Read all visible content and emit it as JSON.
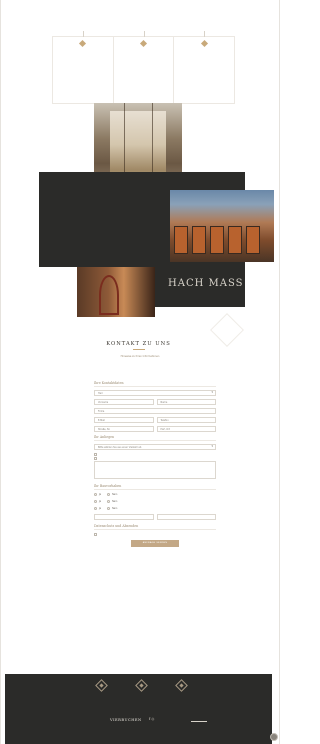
{
  "brand": {
    "wordmark": "HACH MASS"
  },
  "contact": {
    "title": "KONTAKT ZU UNS",
    "privacy_link": "Hinweise zu Ihren Informationen",
    "sections": {
      "personal": "Ihre Kontaktdaten",
      "request": "Ihr Anliegen",
      "details": "Ihr Bauvorhaben",
      "privacy": "Datenschutz und Absenden"
    },
    "fields": {
      "salutation": "Herr",
      "firstname": "Vorname",
      "lastname": "Name",
      "company": "Firma",
      "email": "E-Mail",
      "phone": "Telefon",
      "street": "Straße, Nr.",
      "zip": "PLZ, Ort",
      "topic": "Bitte wählen Sie aus einer Vielzahl ab"
    },
    "options": {
      "yes": "Ja",
      "no": "Nein"
    },
    "submit_label": "ANFRAGE SENDEN"
  },
  "footer": {
    "items": [
      {
        "icon": "diamond-icon"
      },
      {
        "icon": "diamond-icon"
      },
      {
        "icon": "diamond-icon"
      }
    ],
    "brand": "VIERBUCHEN",
    "social": "f ◎",
    "logo": ""
  },
  "colors": {
    "accent": "#c8a97a",
    "dark": "#2b2b29",
    "button": "#c3a886"
  }
}
